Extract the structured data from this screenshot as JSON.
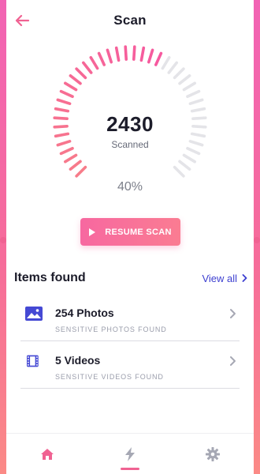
{
  "header": {
    "title": "Scan"
  },
  "scan": {
    "count": "2430",
    "count_label": "Scanned",
    "progress_text": "40%",
    "progress_fraction": 0.4,
    "resume_label": "RESUME SCAN"
  },
  "items_section": {
    "title": "Items found",
    "view_all": "View all",
    "items": [
      {
        "title": "254 Photos",
        "subtitle": "SENSITIVE PHOTOS FOUND",
        "icon": "image-icon"
      },
      {
        "title": "5 Videos",
        "subtitle": "SENSITIVE VIDEOS FOUND",
        "icon": "film-icon"
      }
    ]
  },
  "tabs": [
    {
      "icon": "home-icon",
      "active": false
    },
    {
      "icon": "lightning-icon",
      "active": true
    },
    {
      "icon": "gear-icon",
      "active": false
    }
  ],
  "colors": {
    "accent_pink": "#f06292",
    "gauge_active_start": "#f6599f",
    "gauge_active_end": "#f77c8a",
    "gauge_inactive": "#e4e4e8",
    "link_blue": "#3d3fd0",
    "icon_indigo": "#4549d4"
  }
}
